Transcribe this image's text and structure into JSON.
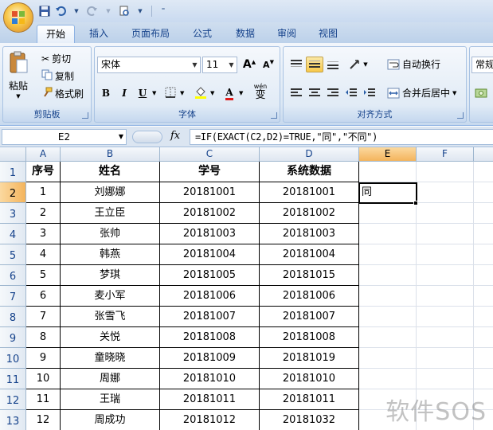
{
  "tabs": [
    "开始",
    "插入",
    "页面布局",
    "公式",
    "数据",
    "审阅",
    "视图"
  ],
  "ribbon": {
    "clipboard": {
      "paste": "粘贴",
      "cut": "剪切",
      "copy": "复制",
      "format_painter": "格式刷",
      "label": "剪贴板"
    },
    "font": {
      "font_name": "宋体",
      "font_size": "11",
      "grow": "A",
      "shrink": "A",
      "bold": "B",
      "italic": "I",
      "underline": "U",
      "color_a": "A",
      "phonetic": "wén",
      "phonetic_char": "变",
      "label": "字体"
    },
    "alignment": {
      "wrap_text": "自动换行",
      "merge_center": "合并后居中",
      "label": "对齐方式"
    },
    "number": {
      "format": "常规"
    }
  },
  "formula_bar": {
    "name_box": "E2",
    "fx": "fx",
    "formula": "=IF(EXACT(C2,D2)=TRUE,\"同\",\"不同\")"
  },
  "columns": [
    "A",
    "B",
    "C",
    "D",
    "E",
    "F"
  ],
  "rows": [
    {
      "num": "1",
      "a": "序号",
      "b": "姓名",
      "c": "学号",
      "d": "系统数据",
      "e": ""
    },
    {
      "num": "2",
      "a": "1",
      "b": "刘娜娜",
      "c": "20181001",
      "d": "20181001",
      "e": "同"
    },
    {
      "num": "3",
      "a": "2",
      "b": "王立臣",
      "c": "20181002",
      "d": "20181002",
      "e": ""
    },
    {
      "num": "4",
      "a": "3",
      "b": "张帅",
      "c": "20181003",
      "d": "20181003",
      "e": ""
    },
    {
      "num": "5",
      "a": "4",
      "b": "韩燕",
      "c": "20181004",
      "d": "20181004",
      "e": ""
    },
    {
      "num": "6",
      "a": "5",
      "b": "梦琪",
      "c": "20181005",
      "d": "20181015",
      "e": ""
    },
    {
      "num": "7",
      "a": "6",
      "b": "麦小军",
      "c": "20181006",
      "d": "20181006",
      "e": ""
    },
    {
      "num": "8",
      "a": "7",
      "b": "张雪飞",
      "c": "20181007",
      "d": "20181007",
      "e": ""
    },
    {
      "num": "9",
      "a": "8",
      "b": "关悦",
      "c": "20181008",
      "d": "20181008",
      "e": ""
    },
    {
      "num": "10",
      "a": "9",
      "b": "童晓晓",
      "c": "20181009",
      "d": "20181019",
      "e": ""
    },
    {
      "num": "11",
      "a": "10",
      "b": "周娜",
      "c": "20181010",
      "d": "20181010",
      "e": ""
    },
    {
      "num": "12",
      "a": "11",
      "b": "王瑞",
      "c": "20181011",
      "d": "20181011",
      "e": ""
    },
    {
      "num": "13",
      "a": "12",
      "b": "周成功",
      "c": "20181012",
      "d": "20181032",
      "e": ""
    }
  ],
  "watermark": "软件SOS"
}
